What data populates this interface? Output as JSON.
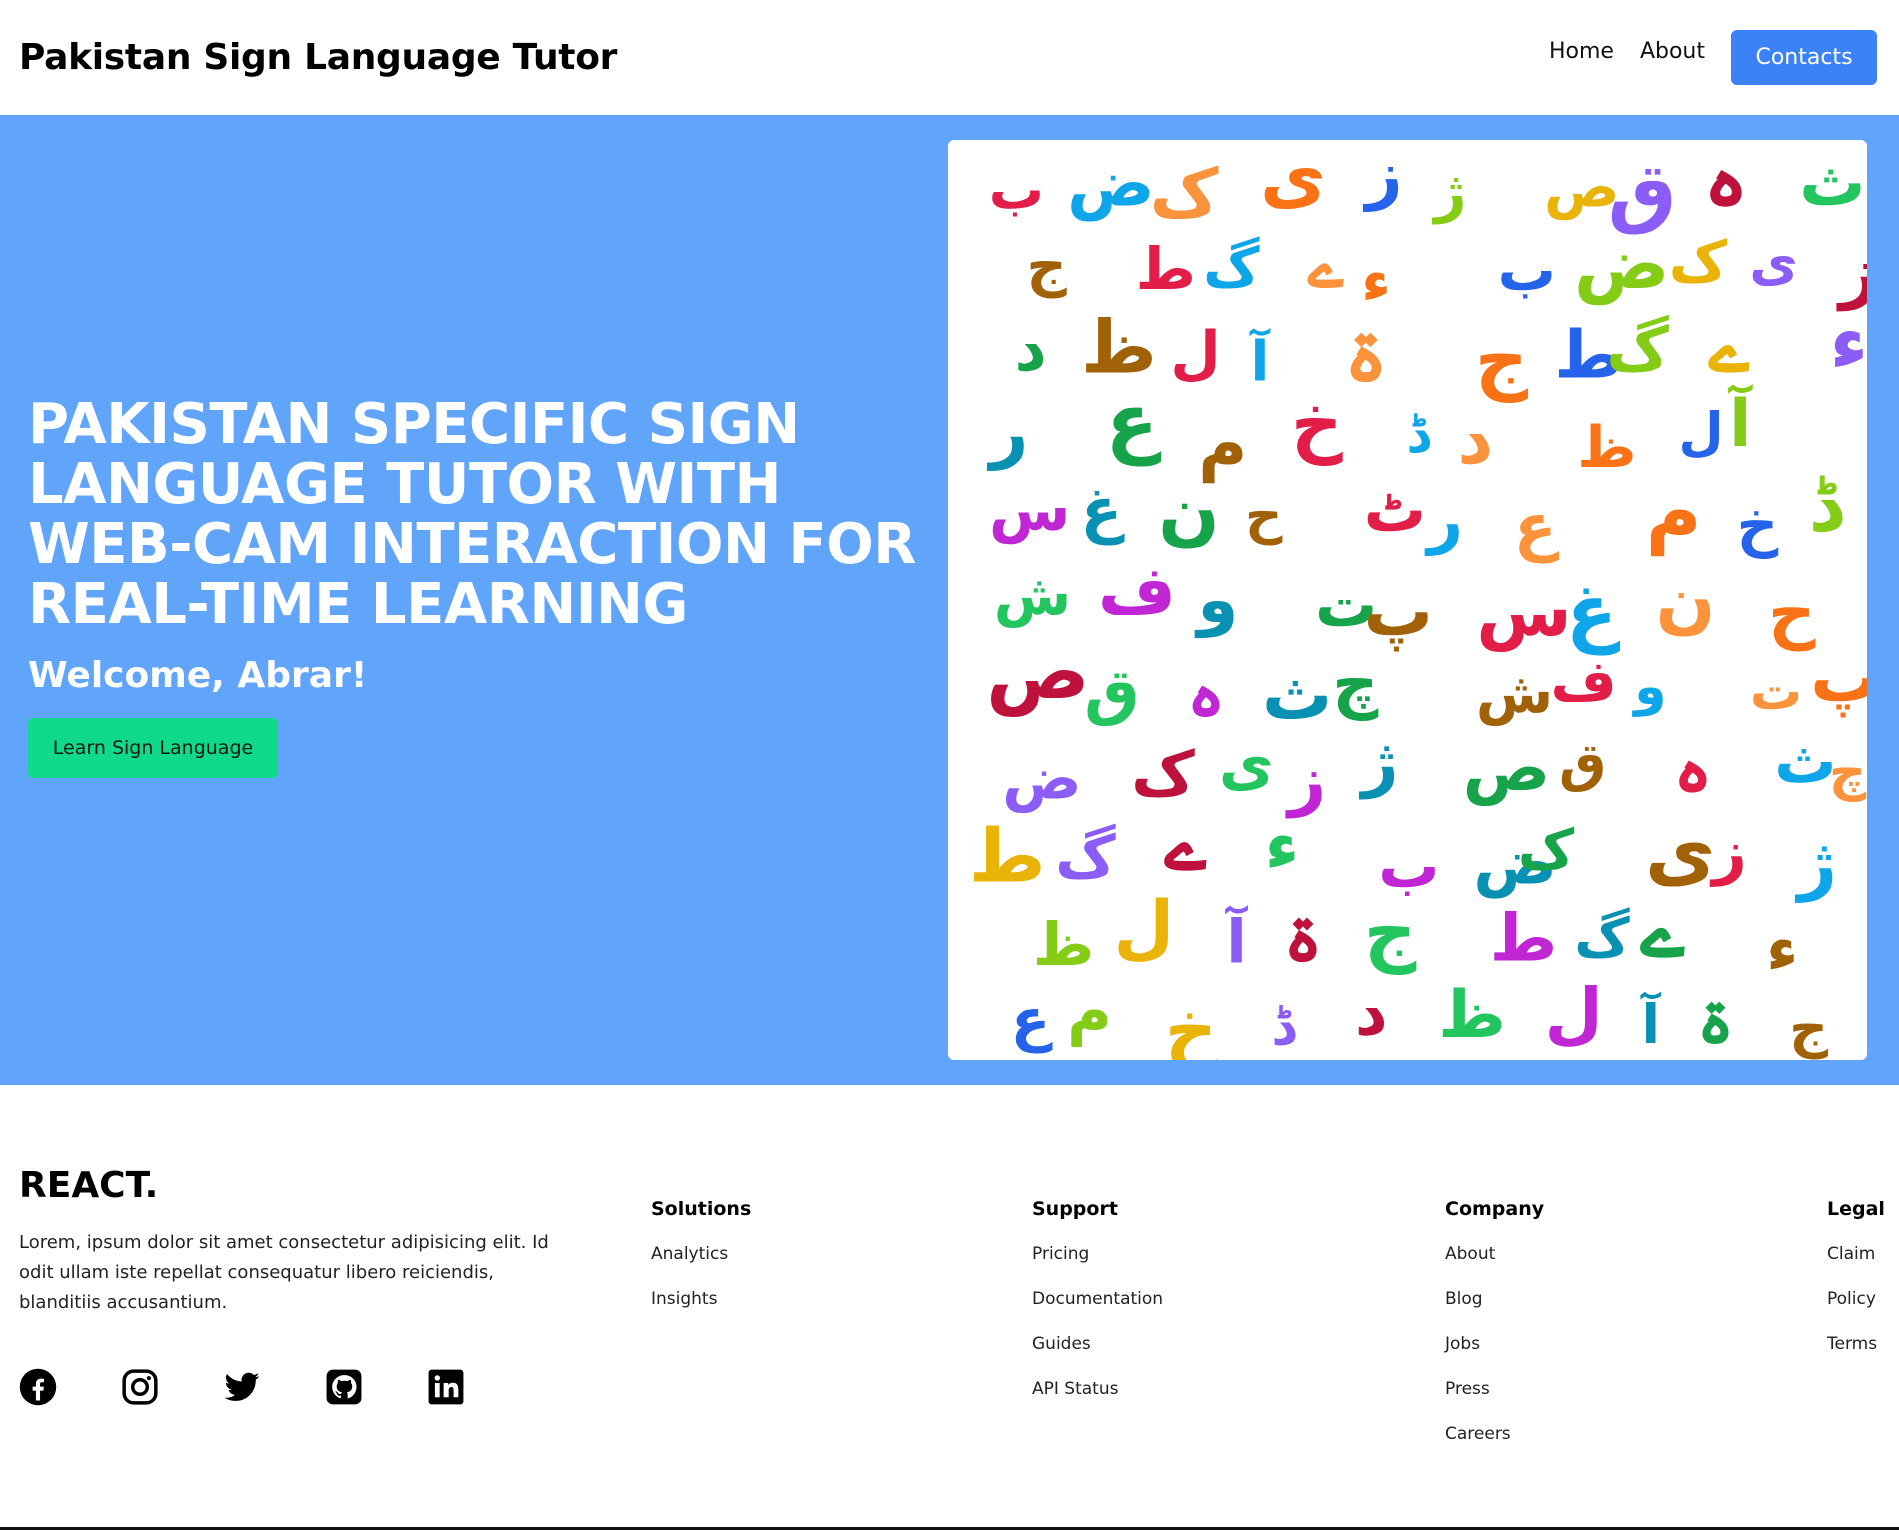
{
  "header": {
    "brand": "Pakistan Sign Language Tutor",
    "nav": {
      "home": "Home",
      "about": "About",
      "contacts": "Contacts"
    }
  },
  "hero": {
    "title": "PAKISTAN SPECIFIC SIGN LANGUAGE TUTOR WITH WEB-CAM INTERACTION FOR REAL-TIME LEARNING",
    "welcome": "Welcome, Abrar!",
    "cta": "Learn Sign Language",
    "image_letters": [
      "ب",
      "ج",
      "د",
      "ر",
      "س",
      "ش",
      "ص",
      "ض",
      "ط",
      "ظ",
      "ع",
      "غ",
      "ف",
      "ق",
      "ک",
      "گ",
      "ل",
      "م",
      "ن",
      "و",
      "ہ",
      "ی",
      "ے",
      "آ",
      "خ",
      "ح",
      "ت",
      "ث",
      "ز",
      "ء",
      "ۃ",
      "ڈ",
      "ٹ",
      "پ",
      "چ",
      "ژ"
    ],
    "letter_colors": [
      "#e11d48",
      "#f97316",
      "#eab308",
      "#22c55e",
      "#16a34a",
      "#0ea5e9",
      "#2563eb",
      "#8b5cf6",
      "#c026d3",
      "#a16207",
      "#fb923c",
      "#84cc16",
      "#be123c",
      "#0891b2"
    ]
  },
  "footer": {
    "logo": "REACT.",
    "description": "Lorem, ipsum dolor sit amet consectetur adipisicing elit. Id odit ullam iste repellat consequatur libero reiciendis, blanditiis accusantium.",
    "socials": [
      "facebook-icon",
      "instagram-icon",
      "twitter-icon",
      "github-icon",
      "linkedin-icon"
    ],
    "columns": {
      "solutions": {
        "title": "Solutions",
        "links": [
          "Analytics",
          "Insights"
        ]
      },
      "support": {
        "title": "Support",
        "links": [
          "Pricing",
          "Documentation",
          "Guides",
          "API Status"
        ]
      },
      "company": {
        "title": "Company",
        "links": [
          "About",
          "Blog",
          "Jobs",
          "Press",
          "Careers"
        ]
      },
      "legal": {
        "title": "Legal",
        "links": [
          "Claim",
          "Policy",
          "Terms"
        ]
      }
    }
  }
}
